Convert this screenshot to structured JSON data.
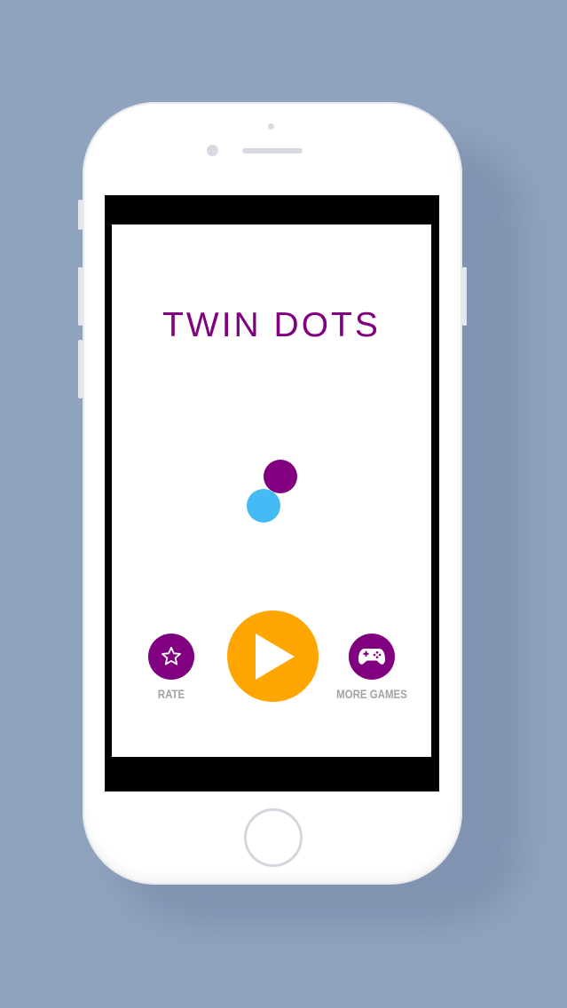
{
  "app": {
    "title": "TWIN DOTS"
  },
  "colors": {
    "background": "#8fa3bf",
    "accent_purple": "#800080",
    "dot_blue": "#44bbf4",
    "play_orange": "#ffa500",
    "label_gray": "#a4a4a4"
  },
  "dots": [
    {
      "name": "purple-dot",
      "color": "#800080"
    },
    {
      "name": "blue-dot",
      "color": "#44bbf4"
    }
  ],
  "buttons": {
    "rate": {
      "label": "RATE",
      "icon": "star-outline-icon"
    },
    "play": {
      "label": "",
      "icon": "play-icon"
    },
    "more_games": {
      "label": "MORE GAMES",
      "icon": "gamepad-icon"
    }
  }
}
